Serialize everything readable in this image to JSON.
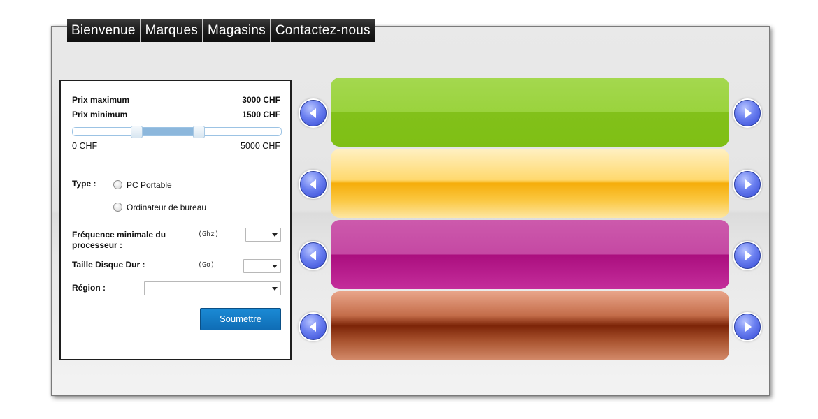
{
  "nav": {
    "tabs": [
      "Bienvenue",
      "Marques",
      "Magasins",
      "Contactez-nous"
    ]
  },
  "filter": {
    "price_max_label": "Prix maximum",
    "price_max_value": "3000 CHF",
    "price_min_label": "Prix minimum",
    "price_min_value": "1500 CHF",
    "slider": {
      "range_min_label": "0 CHF",
      "range_max_label": "5000 CHF",
      "low_value": 1500,
      "high_value": 3000,
      "min": 0,
      "max": 5000
    },
    "type_label": "Type :",
    "type_options": [
      "PC Portable",
      "Ordinateur de bureau"
    ],
    "cpu_label": "Fréquence minimale du processeur :",
    "cpu_unit": "(Ghz)",
    "cpu_value": "",
    "disk_label": "Taille Disque Dur :",
    "disk_unit": "(Go)",
    "disk_value": "",
    "region_label": "Région :",
    "region_value": "",
    "submit_label": "Soumettre"
  },
  "carousel": {
    "rows": [
      {
        "color": "#8cc820"
      },
      {
        "color": "#f8bd20"
      },
      {
        "color": "#b5188a"
      },
      {
        "color": "#8a3414"
      }
    ]
  }
}
